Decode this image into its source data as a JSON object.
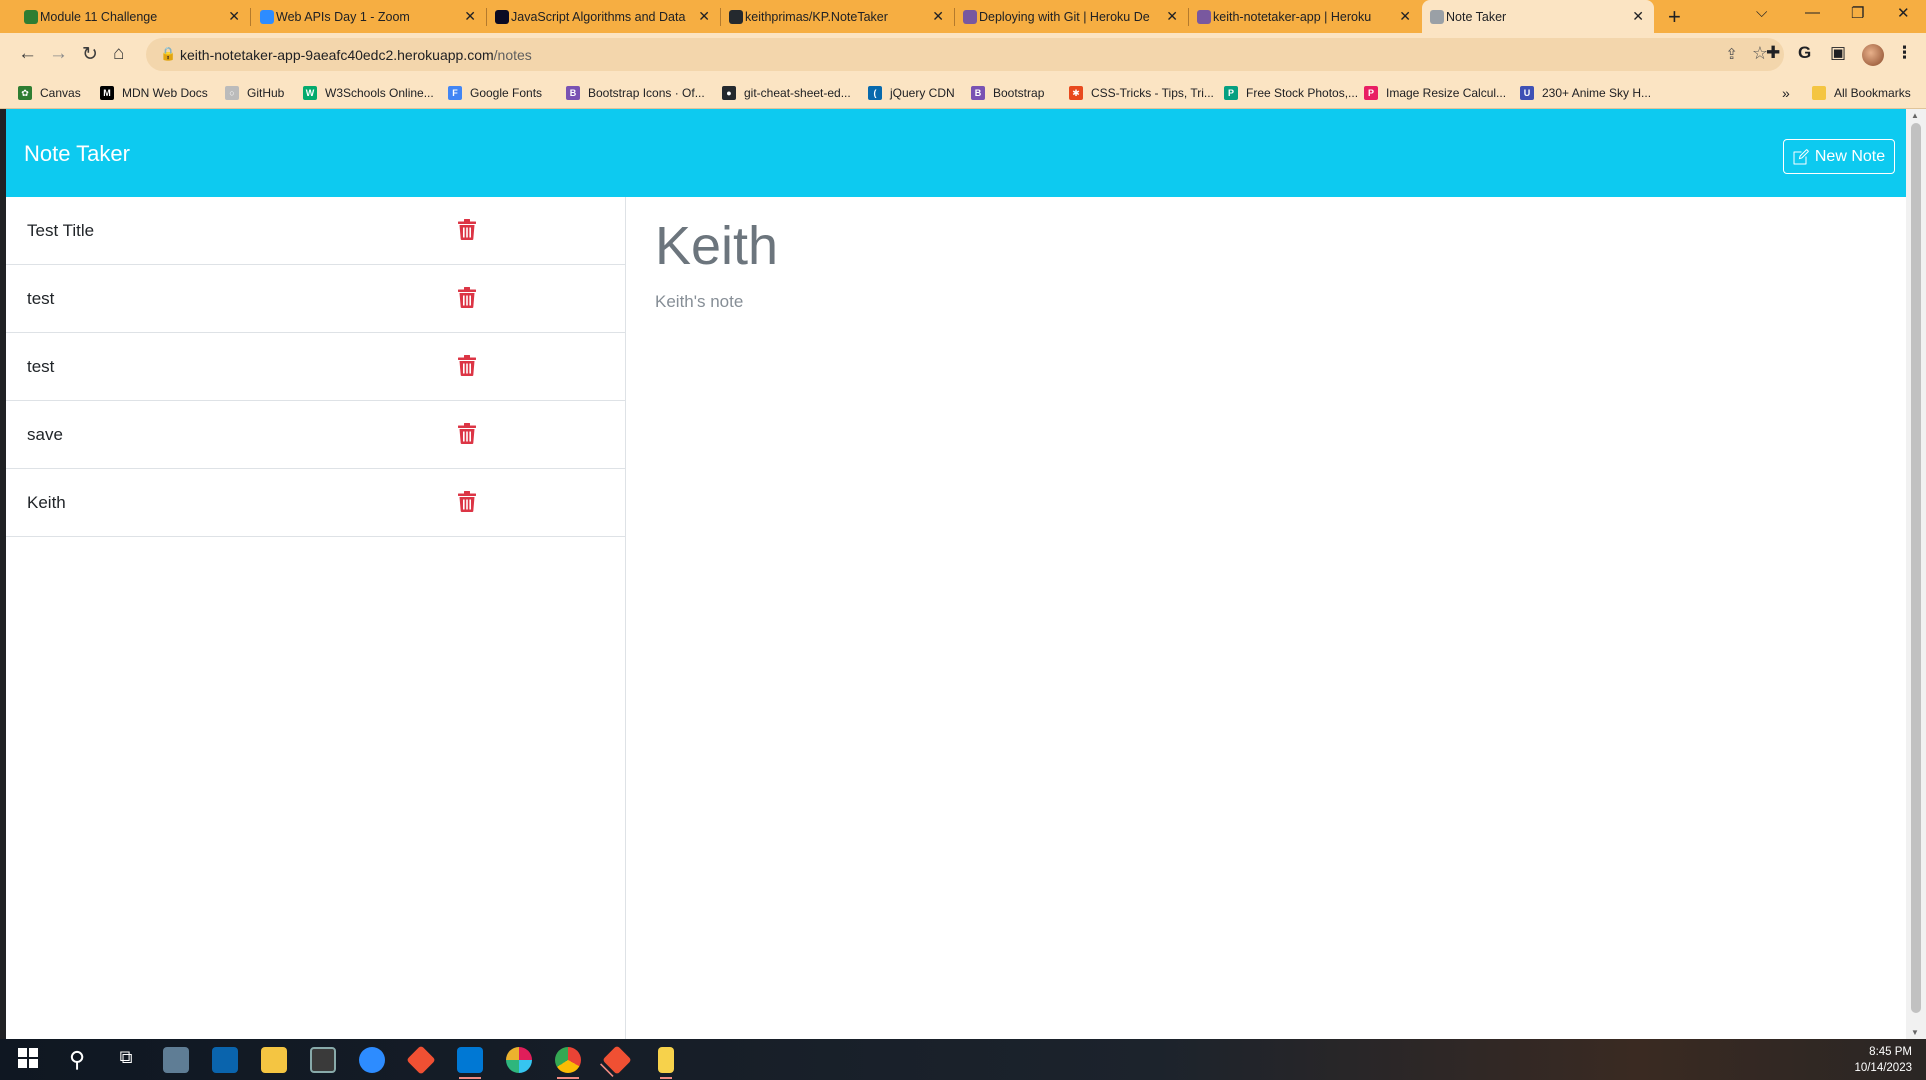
{
  "browser": {
    "tabs": [
      {
        "title": "Module 11 Challenge",
        "icon": "canvas-icon",
        "color": "#2e7d32"
      },
      {
        "title": "Web APIs Day 1 - Zoom",
        "icon": "zoom-icon",
        "color": "#2d8cff"
      },
      {
        "title": "JavaScript Algorithms and Data",
        "icon": "freecodecamp-icon",
        "color": "#0a0a23"
      },
      {
        "title": "keithprimas/KP.NoteTaker",
        "icon": "github-icon",
        "color": "#24292e"
      },
      {
        "title": "Deploying with Git | Heroku De",
        "icon": "heroku-icon",
        "color": "#79589f"
      },
      {
        "title": "keith-notetaker-app | Heroku",
        "icon": "heroku-icon",
        "color": "#79589f"
      },
      {
        "title": "Note Taker",
        "icon": "globe-icon",
        "color": "#9aa0a6"
      }
    ],
    "url_host": "keith-notetaker-app-9aeafc40edc2.herokuapp.com",
    "url_path": "/notes",
    "bookmarks": [
      {
        "label": "Canvas",
        "color": "#2e7d32",
        "glyph": "✿"
      },
      {
        "label": "MDN Web Docs",
        "color": "#000000",
        "glyph": "M"
      },
      {
        "label": "GitHub",
        "color": "#bbbbbb",
        "glyph": "○"
      },
      {
        "label": "W3Schools Online...",
        "color": "#04aa6d",
        "glyph": "W"
      },
      {
        "label": "Google Fonts",
        "color": "#4285f4",
        "glyph": "F"
      },
      {
        "label": "Bootstrap Icons · Of...",
        "color": "#7952b3",
        "glyph": "B"
      },
      {
        "label": "git-cheat-sheet-ed...",
        "color": "#24292e",
        "glyph": "●"
      },
      {
        "label": "jQuery CDN",
        "color": "#0769ad",
        "glyph": "("
      },
      {
        "label": "Bootstrap",
        "color": "#7952b3",
        "glyph": "B"
      },
      {
        "label": "CSS-Tricks - Tips, Tri...",
        "color": "#e8491d",
        "glyph": "✱"
      },
      {
        "label": "Free Stock Photos,...",
        "color": "#05a081",
        "glyph": "P"
      },
      {
        "label": "Image Resize Calcul...",
        "color": "#e91e63",
        "glyph": "P"
      },
      {
        "label": "230+ Anime Sky H...",
        "color": "#3f51b5",
        "glyph": "U"
      }
    ],
    "all_bookmarks": "All Bookmarks"
  },
  "app": {
    "brand": "Note Taker",
    "new_note_label": "New Note",
    "notes": [
      {
        "title": "Test Title"
      },
      {
        "title": "test"
      },
      {
        "title": "test"
      },
      {
        "title": "save"
      },
      {
        "title": "Keith"
      }
    ],
    "active_note": {
      "title": "Keith",
      "text": "Keith's note"
    },
    "colors": {
      "navbar": "#0dcaf0",
      "trash": "#dc3545"
    }
  },
  "taskbar": {
    "time": "8:45 PM",
    "date": "10/14/2023"
  }
}
